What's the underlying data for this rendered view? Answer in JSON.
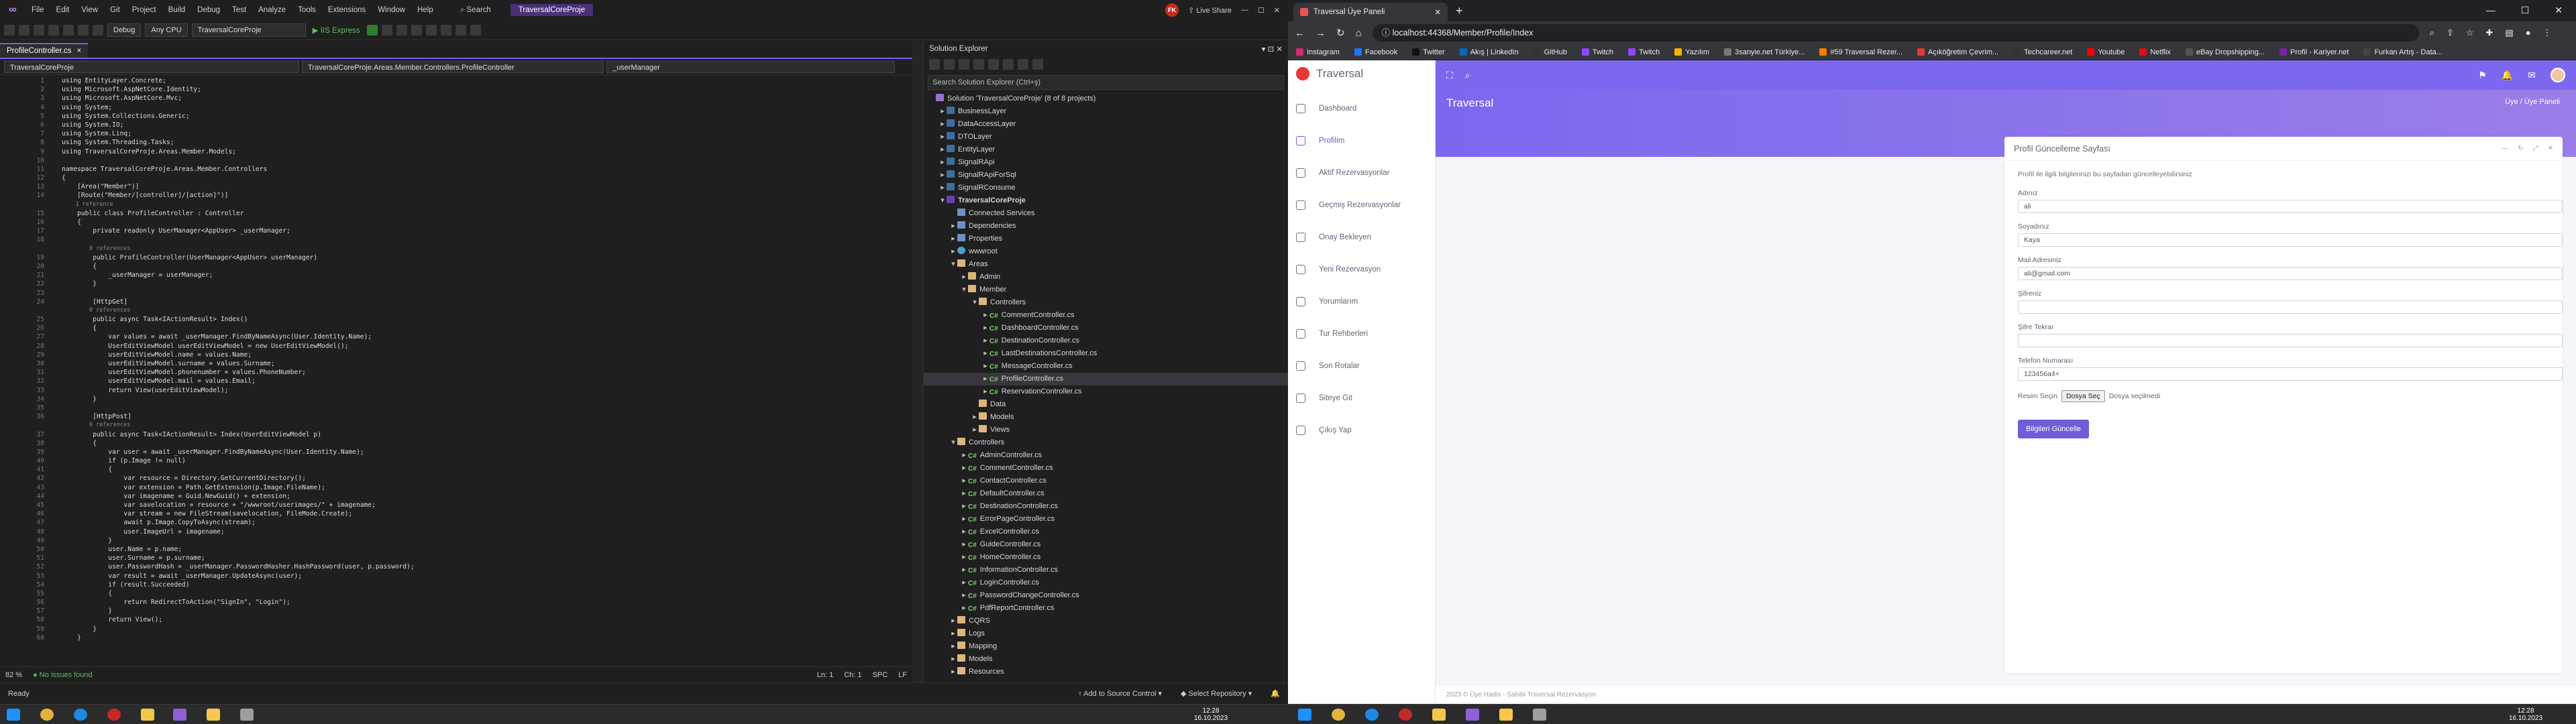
{
  "vs": {
    "menu": [
      "File",
      "Edit",
      "View",
      "Git",
      "Project",
      "Build",
      "Debug",
      "Test",
      "Analyze",
      "Tools",
      "Extensions",
      "Window",
      "Help"
    ],
    "search_label": "Search",
    "project_badge": "TraversalCoreProje",
    "live_share": "Live Share",
    "avatar_initials": "FK",
    "toolbar": {
      "config": "Debug",
      "platform": "Any CPU",
      "startup": "TraversalCoreProje",
      "run": "IIS Express"
    },
    "tab": {
      "name": "ProfileController.cs",
      "close": "×"
    },
    "nav": {
      "project": "TraversalCoreProje",
      "class": "TraversalCoreProje.Areas.Member.Controllers.ProfileController",
      "member": "_userManager"
    },
    "code_lines": [
      {
        "n": "1",
        "t": "using EntityLayer.Concrete;"
      },
      {
        "n": "2",
        "t": "using Microsoft.AspNetCore.Identity;"
      },
      {
        "n": "3",
        "t": "using Microsoft.AspNetCore.Mvc;"
      },
      {
        "n": "4",
        "t": "using System;"
      },
      {
        "n": "5",
        "t": "using System.Collections.Generic;"
      },
      {
        "n": "6",
        "t": "using System.IO;"
      },
      {
        "n": "7",
        "t": "using System.Linq;"
      },
      {
        "n": "8",
        "t": "using System.Threading.Tasks;"
      },
      {
        "n": "9",
        "t": "using TraversalCoreProje.Areas.Member.Models;"
      },
      {
        "n": "10",
        "t": ""
      },
      {
        "n": "11",
        "t": "namespace TraversalCoreProje.Areas.Member.Controllers"
      },
      {
        "n": "12",
        "t": "{"
      },
      {
        "n": "13",
        "t": "    [Area(\"Member\")]"
      },
      {
        "n": "14",
        "t": "    [Route(\"Member/[controller]/[action]\")]"
      },
      {
        "n": "",
        "t": "    1 reference",
        "hint": true
      },
      {
        "n": "15",
        "t": "    public class ProfileController : Controller"
      },
      {
        "n": "16",
        "t": "    {"
      },
      {
        "n": "17",
        "t": "        private readonly UserManager<AppUser> _userManager;"
      },
      {
        "n": "18",
        "t": ""
      },
      {
        "n": "",
        "t": "        0 references",
        "hint": true
      },
      {
        "n": "19",
        "t": "        public ProfileController(UserManager<AppUser> userManager)"
      },
      {
        "n": "20",
        "t": "        {"
      },
      {
        "n": "21",
        "t": "            _userManager = userManager;"
      },
      {
        "n": "22",
        "t": "        }"
      },
      {
        "n": "23",
        "t": ""
      },
      {
        "n": "24",
        "t": "        [HttpGet]"
      },
      {
        "n": "",
        "t": "        0 references",
        "hint": true
      },
      {
        "n": "25",
        "t": "        public async Task<IActionResult> Index()"
      },
      {
        "n": "26",
        "t": "        {"
      },
      {
        "n": "27",
        "t": "            var values = await _userManager.FindByNameAsync(User.Identity.Name);"
      },
      {
        "n": "28",
        "t": "            UserEditViewModel userEditViewModel = new UserEditViewModel();"
      },
      {
        "n": "29",
        "t": "            userEditViewModel.name = values.Name;"
      },
      {
        "n": "30",
        "t": "            userEditViewModel.surname = values.Surname;"
      },
      {
        "n": "31",
        "t": "            userEditViewModel.phonenumber = values.PhoneNumber;"
      },
      {
        "n": "32",
        "t": "            userEditViewModel.mail = values.Email;"
      },
      {
        "n": "33",
        "t": "            return View(userEditViewModel);"
      },
      {
        "n": "34",
        "t": "        }"
      },
      {
        "n": "35",
        "t": ""
      },
      {
        "n": "36",
        "t": "        [HttpPost]"
      },
      {
        "n": "",
        "t": "        0 references",
        "hint": true
      },
      {
        "n": "37",
        "t": "        public async Task<IActionResult> Index(UserEditViewModel p)"
      },
      {
        "n": "38",
        "t": "        {"
      },
      {
        "n": "39",
        "t": "            var user = await _userManager.FindByNameAsync(User.Identity.Name);"
      },
      {
        "n": "40",
        "t": "            if (p.Image != null)"
      },
      {
        "n": "41",
        "t": "            {"
      },
      {
        "n": "42",
        "t": "                var resource = Directory.GetCurrentDirectory();"
      },
      {
        "n": "43",
        "t": "                var extension = Path.GetExtension(p.Image.FileName);"
      },
      {
        "n": "44",
        "t": "                var imagename = Guid.NewGuid() + extension;"
      },
      {
        "n": "45",
        "t": "                var savelocation = resource + \"/wwwroot/userimages/\" + imagename;"
      },
      {
        "n": "46",
        "t": "                var stream = new FileStream(savelocation, FileMode.Create);"
      },
      {
        "n": "47",
        "t": "                await p.Image.CopyToAsync(stream);"
      },
      {
        "n": "48",
        "t": "                user.ImageUrl = imagename;"
      },
      {
        "n": "49",
        "t": "            }"
      },
      {
        "n": "50",
        "t": "            user.Name = p.name;"
      },
      {
        "n": "51",
        "t": "            user.Surname = p.surname;"
      },
      {
        "n": "52",
        "t": "            user.PasswordHash = _userManager.PasswordHasher.HashPassword(user, p.password);"
      },
      {
        "n": "53",
        "t": "            var result = await _userManager.UpdateAsync(user);"
      },
      {
        "n": "54",
        "t": "            if (result.Succeeded)"
      },
      {
        "n": "55",
        "t": "            {"
      },
      {
        "n": "56",
        "t": "                return RedirectToAction(\"SignIn\", \"Login\");"
      },
      {
        "n": "57",
        "t": "            }"
      },
      {
        "n": "58",
        "t": "            return View();"
      },
      {
        "n": "59",
        "t": "        }"
      },
      {
        "n": "60",
        "t": "    }"
      }
    ],
    "editor_status": {
      "zoom": "82 %",
      "issues": "No issues found",
      "ln": "Ln: 1",
      "ch": "Ch: 1",
      "enc": "SPC",
      "eol": "LF"
    },
    "se": {
      "title": "Solution Explorer",
      "search": "Search Solution Explorer (Ctrl+ş)",
      "nodes": [
        {
          "label": "Solution 'TraversalCoreProje' (8 of 8 projects)",
          "d": 0,
          "arr": "",
          "ic": "sol"
        },
        {
          "label": "BusinessLayer",
          "d": 1,
          "arr": "▸",
          "ic": "proj"
        },
        {
          "label": "DataAccessLayer",
          "d": 1,
          "arr": "▸",
          "ic": "proj"
        },
        {
          "label": "DTOLayer",
          "d": 1,
          "arr": "▸",
          "ic": "proj"
        },
        {
          "label": "EntityLayer",
          "d": 1,
          "arr": "▸",
          "ic": "proj"
        },
        {
          "label": "SignalRApi",
          "d": 1,
          "arr": "▸",
          "ic": "proj"
        },
        {
          "label": "SignalRApiForSql",
          "d": 1,
          "arr": "▸",
          "ic": "proj"
        },
        {
          "label": "SignalRConsume",
          "d": 1,
          "arr": "▸",
          "ic": "proj"
        },
        {
          "label": "TraversalCoreProje",
          "d": 1,
          "arr": "▾",
          "ic": "cs-proj",
          "bold": true
        },
        {
          "label": "Connected Services",
          "d": 2,
          "arr": "",
          "ic": "dep"
        },
        {
          "label": "Dependencies",
          "d": 2,
          "arr": "▸",
          "ic": "dep"
        },
        {
          "label": "Properties",
          "d": 2,
          "arr": "▸",
          "ic": "dep"
        },
        {
          "label": "wwwroot",
          "d": 2,
          "arr": "▸",
          "ic": "web"
        },
        {
          "label": "Areas",
          "d": 2,
          "arr": "▾",
          "ic": "folder"
        },
        {
          "label": "Admin",
          "d": 3,
          "arr": "▸",
          "ic": "folder"
        },
        {
          "label": "Member",
          "d": 3,
          "arr": "▾",
          "ic": "folder"
        },
        {
          "label": "Controllers",
          "d": 4,
          "arr": "▾",
          "ic": "folder"
        },
        {
          "label": "CommentController.cs",
          "d": 5,
          "arr": "▸",
          "ic": "cs"
        },
        {
          "label": "DashboardController.cs",
          "d": 5,
          "arr": "▸",
          "ic": "cs"
        },
        {
          "label": "DestinationController.cs",
          "d": 5,
          "arr": "▸",
          "ic": "cs"
        },
        {
          "label": "LastDestinationsController.cs",
          "d": 5,
          "arr": "▸",
          "ic": "cs"
        },
        {
          "label": "MessageController.cs",
          "d": 5,
          "arr": "▸",
          "ic": "cs"
        },
        {
          "label": "ProfileController.cs",
          "d": 5,
          "arr": "▸",
          "ic": "cs",
          "sel": true
        },
        {
          "label": "ReservationController.cs",
          "d": 5,
          "arr": "▸",
          "ic": "cs"
        },
        {
          "label": "Data",
          "d": 4,
          "arr": "",
          "ic": "folder"
        },
        {
          "label": "Models",
          "d": 4,
          "arr": "▸",
          "ic": "folder"
        },
        {
          "label": "Views",
          "d": 4,
          "arr": "▸",
          "ic": "folder"
        },
        {
          "label": "Controllers",
          "d": 2,
          "arr": "▾",
          "ic": "folder"
        },
        {
          "label": "AdminController.cs",
          "d": 3,
          "arr": "▸",
          "ic": "cs"
        },
        {
          "label": "CommentController.cs",
          "d": 3,
          "arr": "▸",
          "ic": "cs"
        },
        {
          "label": "ContactController.cs",
          "d": 3,
          "arr": "▸",
          "ic": "cs"
        },
        {
          "label": "DefaultController.cs",
          "d": 3,
          "arr": "▸",
          "ic": "cs"
        },
        {
          "label": "DestinationController.cs",
          "d": 3,
          "arr": "▸",
          "ic": "cs"
        },
        {
          "label": "ErrorPageController.cs",
          "d": 3,
          "arr": "▸",
          "ic": "cs"
        },
        {
          "label": "ExcelController.cs",
          "d": 3,
          "arr": "▸",
          "ic": "cs"
        },
        {
          "label": "GuideController.cs",
          "d": 3,
          "arr": "▸",
          "ic": "cs"
        },
        {
          "label": "HomeController.cs",
          "d": 3,
          "arr": "▸",
          "ic": "cs"
        },
        {
          "label": "InformationController.cs",
          "d": 3,
          "arr": "▸",
          "ic": "cs"
        },
        {
          "label": "LoginController.cs",
          "d": 3,
          "arr": "▸",
          "ic": "cs"
        },
        {
          "label": "PasswordChangeController.cs",
          "d": 3,
          "arr": "▸",
          "ic": "cs"
        },
        {
          "label": "PdfReportController.cs",
          "d": 3,
          "arr": "▸",
          "ic": "cs"
        },
        {
          "label": "CQRS",
          "d": 2,
          "arr": "▸",
          "ic": "folder"
        },
        {
          "label": "Logs",
          "d": 2,
          "arr": "▸",
          "ic": "folder"
        },
        {
          "label": "Mapping",
          "d": 2,
          "arr": "▸",
          "ic": "folder"
        },
        {
          "label": "Models",
          "d": 2,
          "arr": "▸",
          "ic": "folder"
        },
        {
          "label": "Resources",
          "d": 2,
          "arr": "▸",
          "ic": "folder"
        }
      ]
    },
    "status": {
      "ready": "Ready",
      "source_control": "Add to Source Control",
      "repo": "Select Repository"
    }
  },
  "chrome": {
    "tab_title": "Traversal Üye Paneli",
    "url": "localhost:44368/Member/Profile/Index",
    "bookmarks": [
      "Instagram",
      "Facebook",
      "Twitter",
      "Akış | LinkedIn",
      "GitHub",
      "Twitch",
      "Twitch",
      "Yazılım",
      "3sanyie.net Türkiye...",
      "#59 Traversal Rezer...",
      "Açıköğretim Çevrim...",
      "Techcareer.net",
      "Youtube",
      "Netflix",
      "eBay Dropshipping...",
      "Profil - Kariyer.net",
      "Furkan Artış - Data..."
    ],
    "site": {
      "brand": "Traversal",
      "menu": [
        "Dashboard",
        "Profilim",
        "Aktif Rezervasyonlar",
        "Geçmiş Rezervasyonlar",
        "Onay Bekleyen",
        "Yeni Rezervasyon",
        "Yorumlarım",
        "Tur Rehberleri",
        "Son Rotalar",
        "Siteye Git",
        "Çıkış Yap"
      ],
      "hero_title": "Traversal",
      "breadcrumb": "Üye  /  Üye Paneli",
      "card_title": "Profil Güncelleme Sayfası",
      "card_desc": "Profil ile ilgili bilgilerinizi bu sayfadan güncelleyebilirsiniz",
      "fields": [
        {
          "label": "Adınız",
          "value": "ali"
        },
        {
          "label": "Soyadınız",
          "value": "Kaya"
        },
        {
          "label": "Mail Adresiniz",
          "value": "ali@gmail.com"
        },
        {
          "label": "Şifreniz",
          "value": ""
        },
        {
          "label": "Şifre Tekrar",
          "value": ""
        },
        {
          "label": "Telefon Numarası",
          "value": "123456a4+"
        }
      ],
      "file_label": "Resim Seçin",
      "file_button": "Dosya Seç",
      "file_none": "Dosya seçilmedi",
      "submit": "Bilgileri Güncelle",
      "footer": "2023 © Üye Hadis - Sahibi Traversal Rezervasyon"
    }
  },
  "taskbar": {
    "time_left": "12:28",
    "date_left": "16.10.2023",
    "time_right": "12:28",
    "date_right": "16.10.2023"
  },
  "colors": {
    "vs_accent": "#7160e8",
    "site_primary": "#7b68ee"
  }
}
